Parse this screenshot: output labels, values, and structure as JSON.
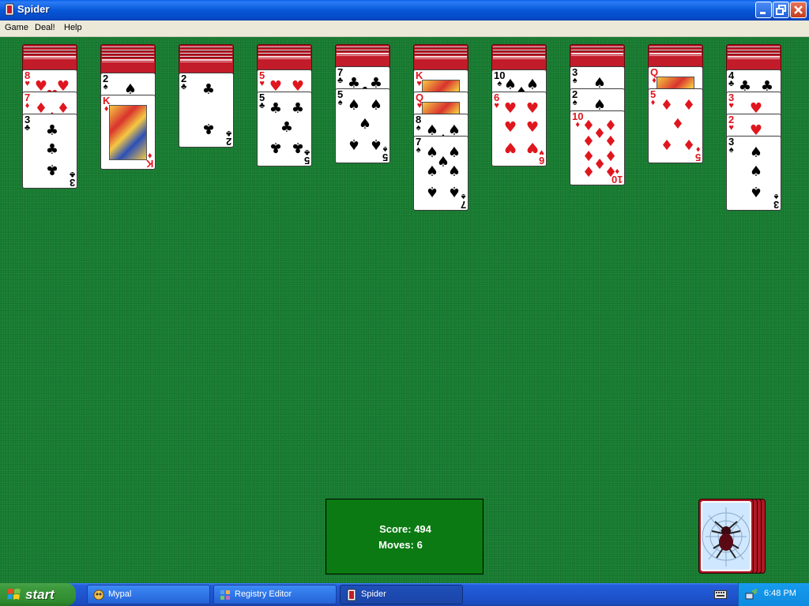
{
  "window": {
    "title": "Spider"
  },
  "menu": {
    "game": "Game",
    "deal": "Deal!",
    "help": "Help"
  },
  "colors": {
    "felt": "#1a7f33",
    "card_back": "#c21b2a",
    "red_suit": "#e0161e",
    "score_bg": "#0b7a12"
  },
  "status": {
    "score_label": "Score:",
    "score": "494",
    "moves_label": "Moves:",
    "moves": "6"
  },
  "tableau": [
    {
      "face_down": 4,
      "face_up": [
        {
          "rank": "8",
          "suit": "♥"
        },
        {
          "rank": "7",
          "suit": "♦"
        },
        {
          "rank": "3",
          "suit": "♣"
        }
      ]
    },
    {
      "face_down": 5,
      "face_up": [
        {
          "rank": "2",
          "suit": "♠"
        },
        {
          "rank": "K",
          "suit": "♦"
        }
      ]
    },
    {
      "face_down": 5,
      "face_up": [
        {
          "rank": "2",
          "suit": "♣"
        }
      ]
    },
    {
      "face_down": 4,
      "face_up": [
        {
          "rank": "5",
          "suit": "♥"
        },
        {
          "rank": "5",
          "suit": "♣"
        }
      ]
    },
    {
      "face_down": 3,
      "face_up": [
        {
          "rank": "7",
          "suit": "♣"
        },
        {
          "rank": "5",
          "suit": "♠"
        }
      ]
    },
    {
      "face_down": 4,
      "face_up": [
        {
          "rank": "K",
          "suit": "♥"
        },
        {
          "rank": "Q",
          "suit": "♥"
        },
        {
          "rank": "8",
          "suit": "♠"
        },
        {
          "rank": "7",
          "suit": "♠"
        }
      ]
    },
    {
      "face_down": 4,
      "face_up": [
        {
          "rank": "10",
          "suit": "♠"
        },
        {
          "rank": "6",
          "suit": "♥"
        }
      ]
    },
    {
      "face_down": 3,
      "face_up": [
        {
          "rank": "3",
          "suit": "♠"
        },
        {
          "rank": "2",
          "suit": "♠"
        },
        {
          "rank": "10",
          "suit": "♦"
        }
      ]
    },
    {
      "face_down": 3,
      "face_up": [
        {
          "rank": "Q",
          "suit": "♦"
        },
        {
          "rank": "5",
          "suit": "♦"
        }
      ]
    },
    {
      "face_down": 4,
      "face_up": [
        {
          "rank": "4",
          "suit": "♣"
        },
        {
          "rank": "3",
          "suit": "♥"
        },
        {
          "rank": "2",
          "suit": "♥"
        },
        {
          "rank": "3",
          "suit": "♠"
        }
      ]
    }
  ],
  "stock": {
    "piles": 4,
    "icon": "spider-icon"
  },
  "taskbar": {
    "start": "start",
    "tasks": [
      {
        "label": "Mypal",
        "icon": "mypal-icon"
      },
      {
        "label": "Registry Editor",
        "icon": "registry-icon"
      },
      {
        "label": "Spider",
        "icon": "spider-app-icon",
        "active": true
      }
    ],
    "clock": "6:48 PM"
  }
}
